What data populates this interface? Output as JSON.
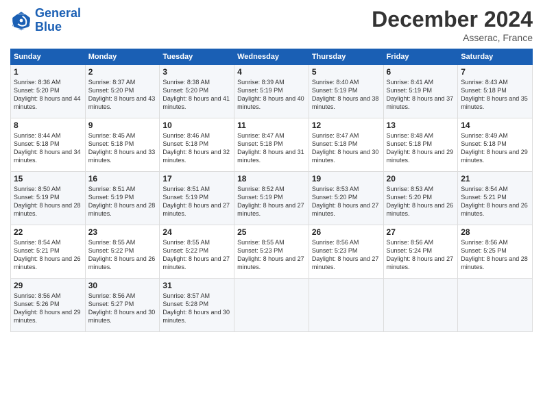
{
  "logo": {
    "line1": "General",
    "line2": "Blue"
  },
  "header": {
    "month": "December 2024",
    "location": "Asserac, France"
  },
  "weekdays": [
    "Sunday",
    "Monday",
    "Tuesday",
    "Wednesday",
    "Thursday",
    "Friday",
    "Saturday"
  ],
  "weeks": [
    [
      {
        "day": "1",
        "sunrise": "Sunrise: 8:36 AM",
        "sunset": "Sunset: 5:20 PM",
        "daylight": "Daylight: 8 hours and 44 minutes."
      },
      {
        "day": "2",
        "sunrise": "Sunrise: 8:37 AM",
        "sunset": "Sunset: 5:20 PM",
        "daylight": "Daylight: 8 hours and 43 minutes."
      },
      {
        "day": "3",
        "sunrise": "Sunrise: 8:38 AM",
        "sunset": "Sunset: 5:20 PM",
        "daylight": "Daylight: 8 hours and 41 minutes."
      },
      {
        "day": "4",
        "sunrise": "Sunrise: 8:39 AM",
        "sunset": "Sunset: 5:19 PM",
        "daylight": "Daylight: 8 hours and 40 minutes."
      },
      {
        "day": "5",
        "sunrise": "Sunrise: 8:40 AM",
        "sunset": "Sunset: 5:19 PM",
        "daylight": "Daylight: 8 hours and 38 minutes."
      },
      {
        "day": "6",
        "sunrise": "Sunrise: 8:41 AM",
        "sunset": "Sunset: 5:19 PM",
        "daylight": "Daylight: 8 hours and 37 minutes."
      },
      {
        "day": "7",
        "sunrise": "Sunrise: 8:43 AM",
        "sunset": "Sunset: 5:18 PM",
        "daylight": "Daylight: 8 hours and 35 minutes."
      }
    ],
    [
      {
        "day": "8",
        "sunrise": "Sunrise: 8:44 AM",
        "sunset": "Sunset: 5:18 PM",
        "daylight": "Daylight: 8 hours and 34 minutes."
      },
      {
        "day": "9",
        "sunrise": "Sunrise: 8:45 AM",
        "sunset": "Sunset: 5:18 PM",
        "daylight": "Daylight: 8 hours and 33 minutes."
      },
      {
        "day": "10",
        "sunrise": "Sunrise: 8:46 AM",
        "sunset": "Sunset: 5:18 PM",
        "daylight": "Daylight: 8 hours and 32 minutes."
      },
      {
        "day": "11",
        "sunrise": "Sunrise: 8:47 AM",
        "sunset": "Sunset: 5:18 PM",
        "daylight": "Daylight: 8 hours and 31 minutes."
      },
      {
        "day": "12",
        "sunrise": "Sunrise: 8:47 AM",
        "sunset": "Sunset: 5:18 PM",
        "daylight": "Daylight: 8 hours and 30 minutes."
      },
      {
        "day": "13",
        "sunrise": "Sunrise: 8:48 AM",
        "sunset": "Sunset: 5:18 PM",
        "daylight": "Daylight: 8 hours and 29 minutes."
      },
      {
        "day": "14",
        "sunrise": "Sunrise: 8:49 AM",
        "sunset": "Sunset: 5:18 PM",
        "daylight": "Daylight: 8 hours and 29 minutes."
      }
    ],
    [
      {
        "day": "15",
        "sunrise": "Sunrise: 8:50 AM",
        "sunset": "Sunset: 5:19 PM",
        "daylight": "Daylight: 8 hours and 28 minutes."
      },
      {
        "day": "16",
        "sunrise": "Sunrise: 8:51 AM",
        "sunset": "Sunset: 5:19 PM",
        "daylight": "Daylight: 8 hours and 28 minutes."
      },
      {
        "day": "17",
        "sunrise": "Sunrise: 8:51 AM",
        "sunset": "Sunset: 5:19 PM",
        "daylight": "Daylight: 8 hours and 27 minutes."
      },
      {
        "day": "18",
        "sunrise": "Sunrise: 8:52 AM",
        "sunset": "Sunset: 5:19 PM",
        "daylight": "Daylight: 8 hours and 27 minutes."
      },
      {
        "day": "19",
        "sunrise": "Sunrise: 8:53 AM",
        "sunset": "Sunset: 5:20 PM",
        "daylight": "Daylight: 8 hours and 27 minutes."
      },
      {
        "day": "20",
        "sunrise": "Sunrise: 8:53 AM",
        "sunset": "Sunset: 5:20 PM",
        "daylight": "Daylight: 8 hours and 26 minutes."
      },
      {
        "day": "21",
        "sunrise": "Sunrise: 8:54 AM",
        "sunset": "Sunset: 5:21 PM",
        "daylight": "Daylight: 8 hours and 26 minutes."
      }
    ],
    [
      {
        "day": "22",
        "sunrise": "Sunrise: 8:54 AM",
        "sunset": "Sunset: 5:21 PM",
        "daylight": "Daylight: 8 hours and 26 minutes."
      },
      {
        "day": "23",
        "sunrise": "Sunrise: 8:55 AM",
        "sunset": "Sunset: 5:22 PM",
        "daylight": "Daylight: 8 hours and 26 minutes."
      },
      {
        "day": "24",
        "sunrise": "Sunrise: 8:55 AM",
        "sunset": "Sunset: 5:22 PM",
        "daylight": "Daylight: 8 hours and 27 minutes."
      },
      {
        "day": "25",
        "sunrise": "Sunrise: 8:55 AM",
        "sunset": "Sunset: 5:23 PM",
        "daylight": "Daylight: 8 hours and 27 minutes."
      },
      {
        "day": "26",
        "sunrise": "Sunrise: 8:56 AM",
        "sunset": "Sunset: 5:23 PM",
        "daylight": "Daylight: 8 hours and 27 minutes."
      },
      {
        "day": "27",
        "sunrise": "Sunrise: 8:56 AM",
        "sunset": "Sunset: 5:24 PM",
        "daylight": "Daylight: 8 hours and 27 minutes."
      },
      {
        "day": "28",
        "sunrise": "Sunrise: 8:56 AM",
        "sunset": "Sunset: 5:25 PM",
        "daylight": "Daylight: 8 hours and 28 minutes."
      }
    ],
    [
      {
        "day": "29",
        "sunrise": "Sunrise: 8:56 AM",
        "sunset": "Sunset: 5:26 PM",
        "daylight": "Daylight: 8 hours and 29 minutes."
      },
      {
        "day": "30",
        "sunrise": "Sunrise: 8:56 AM",
        "sunset": "Sunset: 5:27 PM",
        "daylight": "Daylight: 8 hours and 30 minutes."
      },
      {
        "day": "31",
        "sunrise": "Sunrise: 8:57 AM",
        "sunset": "Sunset: 5:28 PM",
        "daylight": "Daylight: 8 hours and 30 minutes."
      },
      null,
      null,
      null,
      null
    ]
  ]
}
